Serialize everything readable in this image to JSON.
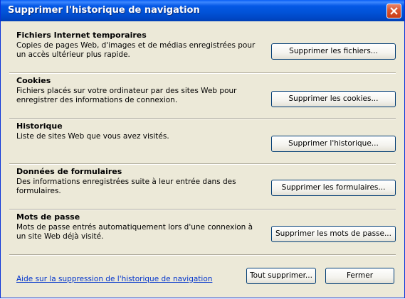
{
  "window": {
    "title": "Supprimer l'historique de navigation"
  },
  "sections": [
    {
      "title": "Fichiers Internet temporaires",
      "description": "Copies de pages Web, d'images et de médias enregistrées pour un accès ultérieur plus rapide.",
      "button_label": "Supprimer les fichiers..."
    },
    {
      "title": "Cookies",
      "description": "Fichiers placés sur votre ordinateur par des sites Web pour enregistrer des informations de connexion.",
      "button_label": "Supprimer les cookies..."
    },
    {
      "title": "Historique",
      "description": "Liste de sites Web que vous avez visités.",
      "button_label": "Supprimer l'historique..."
    },
    {
      "title": "Données de formulaires",
      "description": "Des informations enregistrées suite à leur entrée dans des formulaires.",
      "button_label": "Supprimer les formulaires..."
    },
    {
      "title": "Mots de passe",
      "description": "Mots de passe entrés automatiquement lors d'une connexion à un site Web déjà visité.",
      "button_label": "Supprimer les mots de passe..."
    }
  ],
  "footer": {
    "help_link": "Aide sur la suppression de l'historique de navigation",
    "delete_all_label": "Tout supprimer...",
    "close_label": "Fermer"
  },
  "colors": {
    "titlebar": "#0054e3",
    "dialog_background": "#ece9d8",
    "link": "#0033cc",
    "close_button": "#d9542e"
  }
}
